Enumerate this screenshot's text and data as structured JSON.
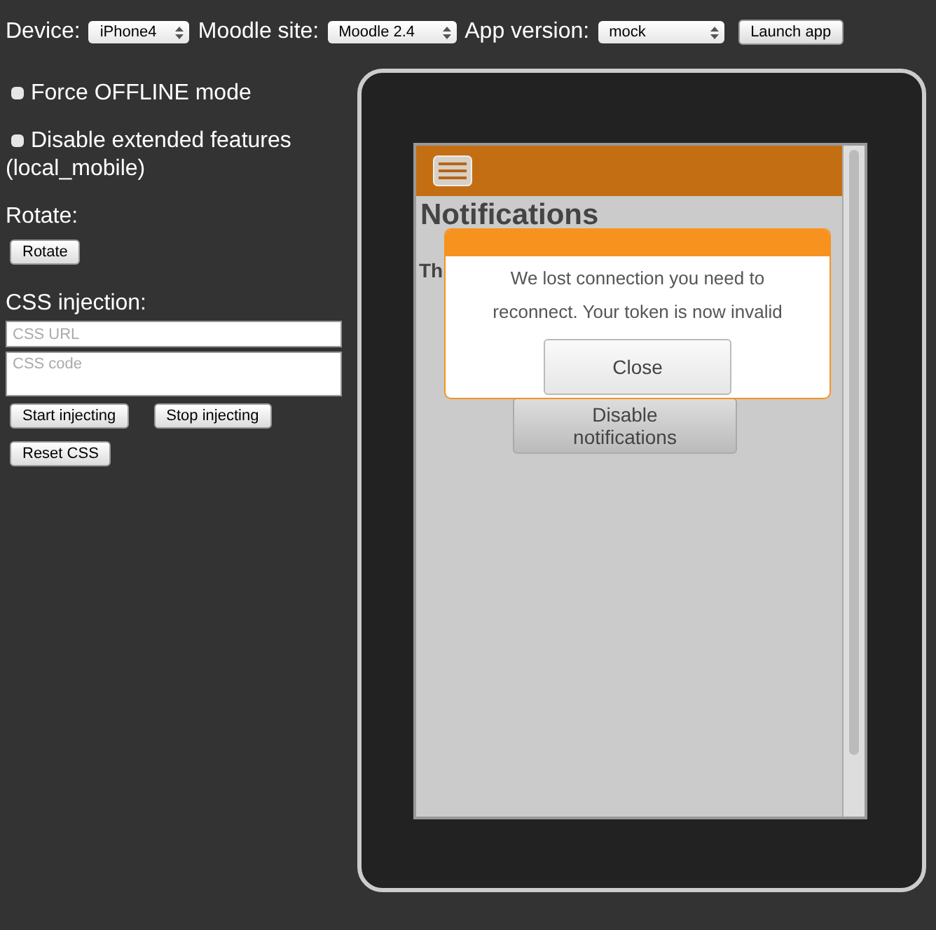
{
  "toolbar": {
    "fields": [
      {
        "label": "Device:",
        "value": "iPhone4"
      },
      {
        "label": "Moodle site:",
        "value": "Moodle 2.4"
      },
      {
        "label": "App version:",
        "value": "mock"
      }
    ],
    "launch_button": "Launch app"
  },
  "options": [
    {
      "label": "Force OFFLINE mode",
      "checked": false
    },
    {
      "label": "Disable extended features (local_mobile)",
      "checked": false
    }
  ],
  "rotate": {
    "heading": "Rotate:",
    "button": "Rotate"
  },
  "css_injection": {
    "heading": "CSS injection:",
    "url_placeholder": "CSS URL",
    "code_placeholder": "CSS code",
    "buttons": [
      "Start injecting",
      "Stop injecting",
      "Reset CSS"
    ]
  },
  "app": {
    "page_title": "Notifications",
    "subtitle_visible": "Th",
    "button": "Disable notifications",
    "dialog": {
      "message": "We lost connection you need to reconnect. Your token is now invalid",
      "button": "Close"
    }
  }
}
